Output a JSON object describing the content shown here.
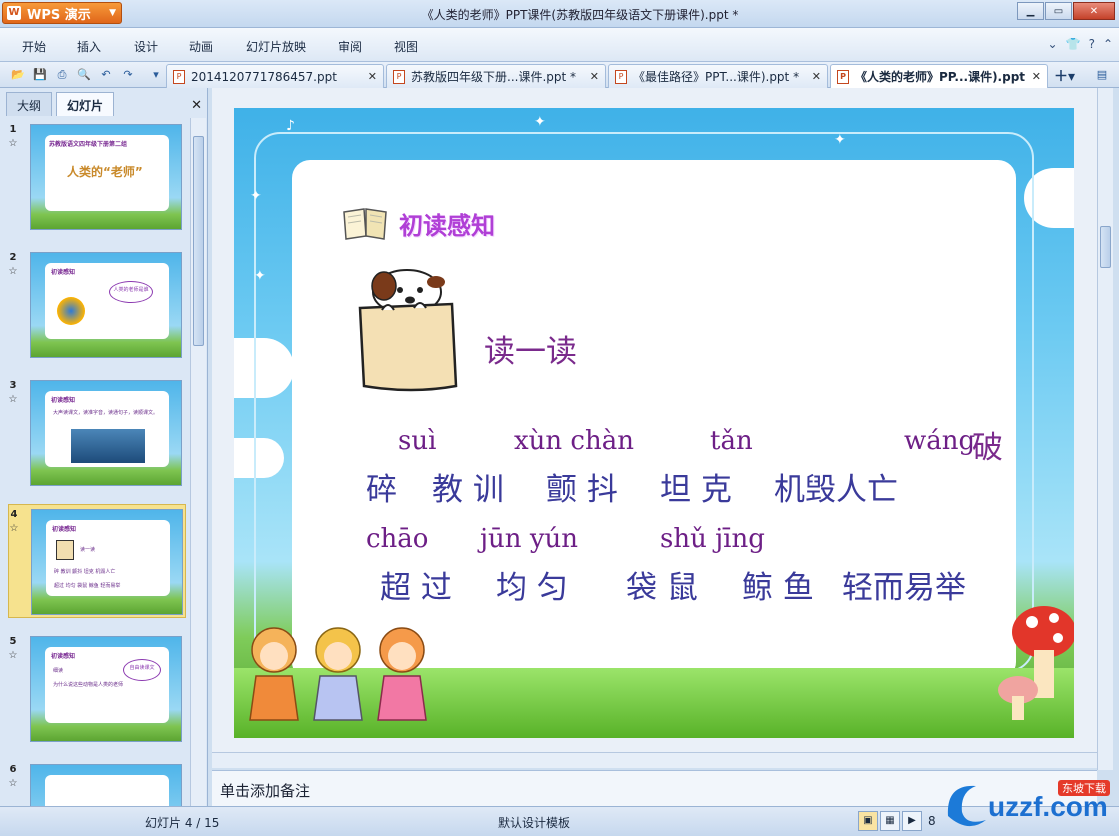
{
  "app": {
    "name": "WPS 演示",
    "window_title": "《人类的老师》PPT课件(苏教版四年级语文下册课件).ppt *"
  },
  "menu": [
    "开始",
    "插入",
    "设计",
    "动画",
    "幻灯片放映",
    "审阅",
    "视图"
  ],
  "doc_tabs": [
    {
      "label": "2014120771786457.ppt"
    },
    {
      "label": "苏教版四年级下册...课件.ppt *"
    },
    {
      "label": "《最佳路径》PPT...课件).ppt *"
    },
    {
      "label": "《人类的老师》PP...课件).ppt *"
    }
  ],
  "left_pane": {
    "tabs": [
      "大纲",
      "幻灯片"
    ],
    "thumbs": [
      {
        "num": "1",
        "lines": [
          "苏教版语文四年级下册第二组",
          "人类的“老师”"
        ]
      },
      {
        "num": "2",
        "lines": [
          "初读感知",
          "人类的老师是谁"
        ]
      },
      {
        "num": "3",
        "lines": [
          "初读感知",
          "大声读课文，读准字音，读通句子，读顺课文。"
        ]
      },
      {
        "num": "4",
        "lines": [
          "初读感知",
          "读一读",
          "碎 教训 颤抖 坦克 机毁人亡",
          "超过 均匀 袋鼠 鲸鱼 轻而易举"
        ]
      },
      {
        "num": "5",
        "lines": [
          "初读感知",
          "细读",
          "为什么说这些动物是人类的老师",
          "自由读课文"
        ]
      },
      {
        "num": "6",
        "lines": []
      }
    ]
  },
  "slide": {
    "section_title": "初读感知",
    "read_label": "读一读",
    "row1_pinyin": [
      "suì",
      "xùn chàn",
      "tǎn",
      "wáng"
    ],
    "row1_last_char": "破",
    "row1_hanzi": [
      "碎",
      "教 训",
      "颤 抖",
      "坦 克",
      "机毁人亡"
    ],
    "row2_pinyin": [
      "chāo",
      "jūn yún",
      "shǔ jīng"
    ],
    "row2_hanzi": [
      "超 过",
      "均 匀",
      "袋 鼠",
      "鲸 鱼",
      "轻而易举"
    ]
  },
  "notes_placeholder": "单击添加备注",
  "status": {
    "slide_counter": "幻灯片 4 / 15",
    "template": "默认设计模板",
    "zoom": "8"
  },
  "watermark": {
    "brand": "uzzf.com",
    "tag": "东坡下载"
  }
}
